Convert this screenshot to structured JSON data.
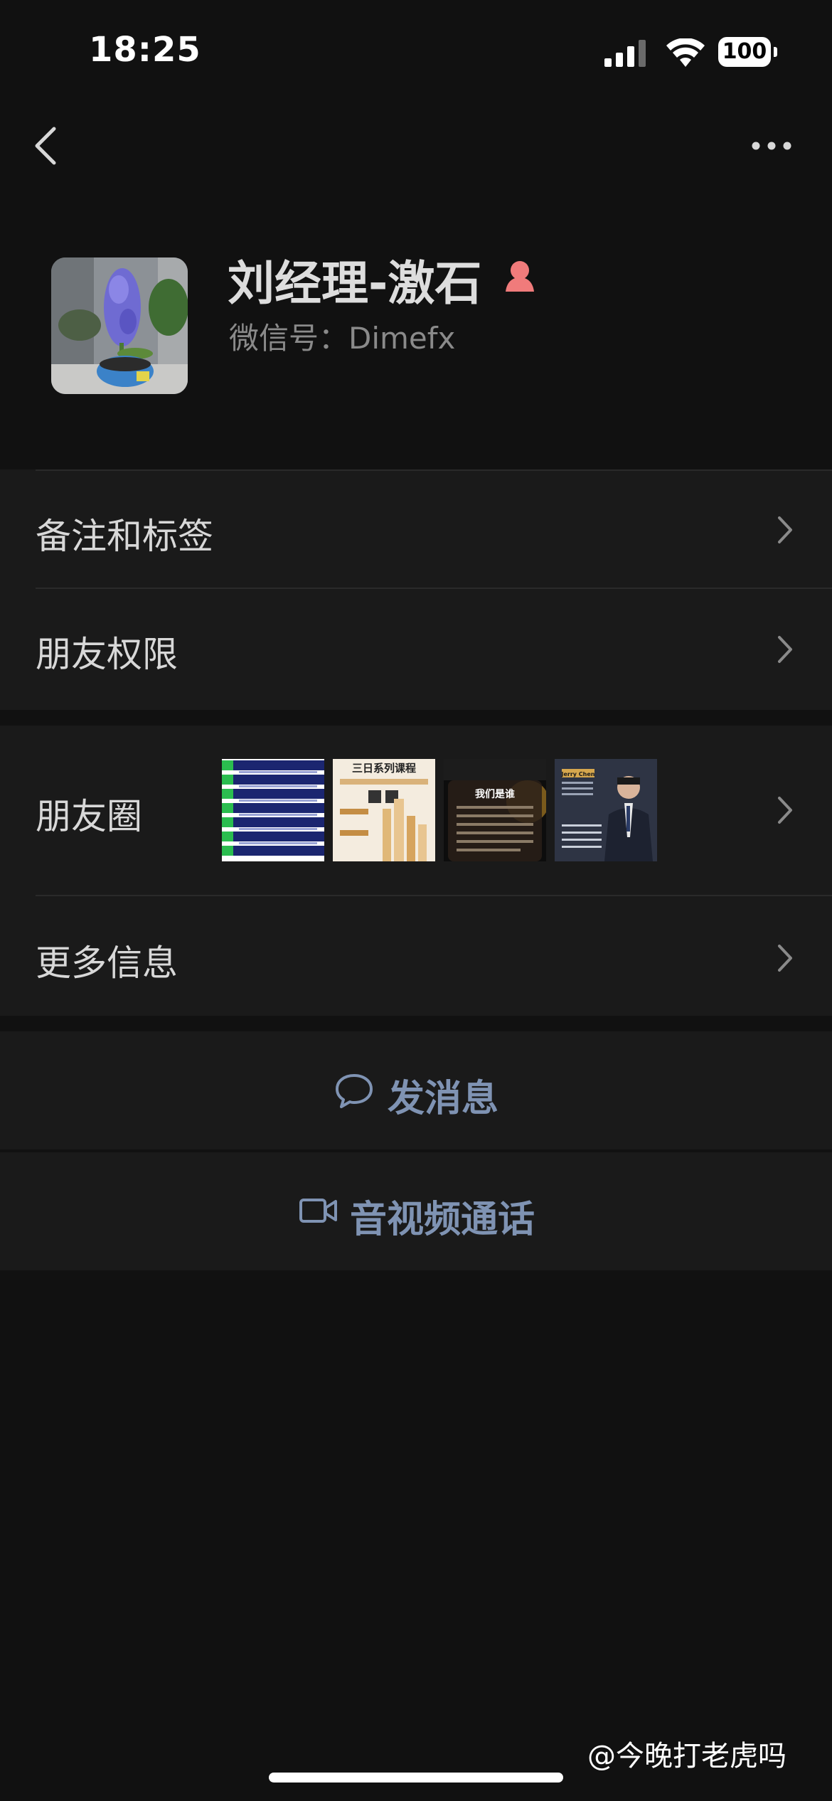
{
  "status_bar": {
    "time": "18:25",
    "battery": "100",
    "icons": [
      "signal-icon",
      "wifi-icon",
      "battery-icon"
    ]
  },
  "nav": {
    "back_icon": "chevron-left-icon",
    "more_icon": "more-icon"
  },
  "profile": {
    "name": "刘经理-激石",
    "gender_icon": "female-icon",
    "wechat_id": "微信号：Dimefx"
  },
  "rows": {
    "remark_tags": "备注和标签",
    "friend_permissions": "朋友权限",
    "moments": "朋友圈",
    "more_info": "更多信息"
  },
  "moments_thumbs": {
    "thumb2_title": "三日系列课程",
    "thumb3_title": "我们是谁",
    "thumb4_name": "Jerry Chen"
  },
  "actions": {
    "send_message": "发消息",
    "video_call": "音视频通话"
  },
  "watermark": "@今晚打老虎吗",
  "colors": {
    "background": "#111111",
    "section": "#1a1a1a",
    "action_blue": "#7f93b3",
    "gender_pink": "#f07b7b"
  }
}
